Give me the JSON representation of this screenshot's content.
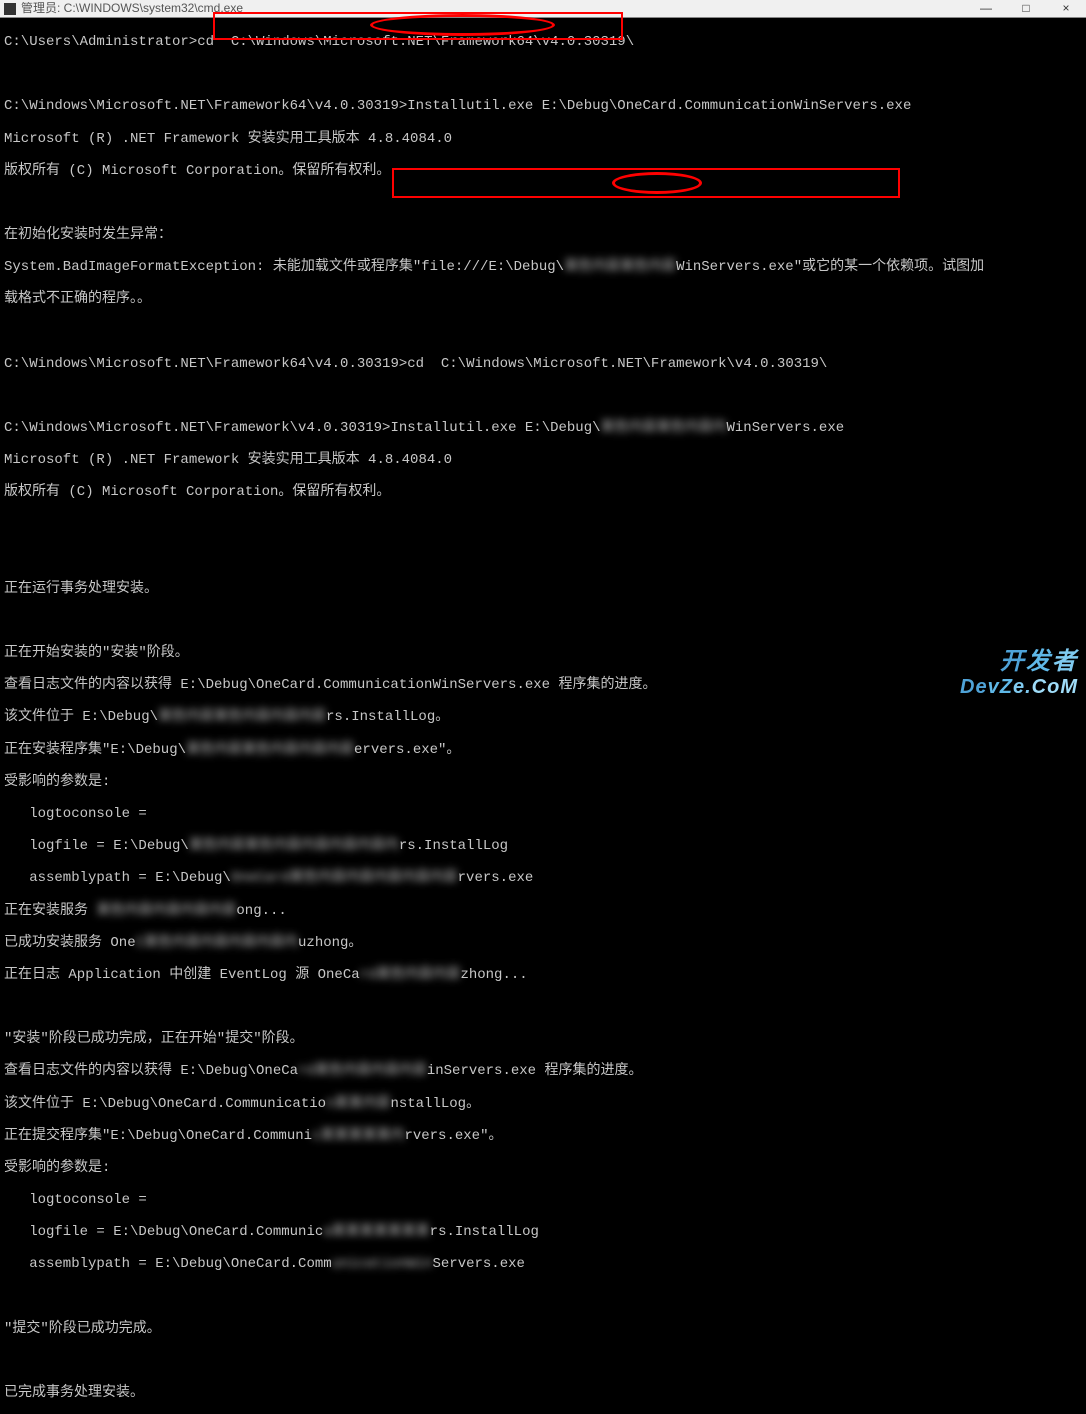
{
  "titlebar": {
    "text": "管理员: C:\\WINDOWS\\system32\\cmd.exe",
    "min": "—",
    "max": "□",
    "close": "×"
  },
  "lines": {
    "l1_prompt": "C:\\Users\\Administrator>",
    "l1_cmd": "cd  C:\\Windows\\Microsoft.NET\\Framework64\\v4.0.30319\\",
    "l2": "",
    "l3": "C:\\Windows\\Microsoft.NET\\Framework64\\v4.0.30319>Installutil.exe E:\\Debug\\OneCard.CommunicationWinServers.exe",
    "l4": "Microsoft (R) .NET Framework 安装实用工具版本 4.8.4084.0",
    "l5": "版权所有 (C) Microsoft Corporation。保留所有权利。",
    "l6": "",
    "l7": "在初始化安装时发生异常：",
    "l8a": "System.BadImageFormatException: 未能加载文件或程序集\"file:///E:\\Debug\\",
    "l8b_blur": "某些内容某些内容",
    "l8c": "WinServers.exe\"或它的某一个依赖项。试图加",
    "l9": "载格式不正确的程序。。",
    "l10": "",
    "l11_prompt": "C:\\Windows\\Microsoft.NET\\Framework64\\v4.0.30319>",
    "l11_cmd": "cd  C:\\Windows\\Microsoft.NET\\Framework\\v4.0.30319\\",
    "l12": "",
    "l13a": "C:\\Windows\\Microsoft.NET\\Framework\\v4.0.30319>Installutil.exe E:\\Debug\\",
    "l13b_blur": "某些内容某些内容内",
    "l13c": "WinServers.exe",
    "l14": "Microsoft (R) .NET Framework 安装实用工具版本 4.8.4084.0",
    "l15": "版权所有 (C) Microsoft Corporation。保留所有权利。",
    "l16": "",
    "l17": "",
    "l18": "正在运行事务处理安装。",
    "l19": "",
    "l20": "正在开始安装的\"安装\"阶段。",
    "l21": "查看日志文件的内容以获得 E:\\Debug\\OneCard.CommunicationWinServers.exe 程序集的进度。",
    "l22a": "该文件位于 E:\\Debug\\",
    "l22b_blur": "某些内容某些内容内容内容",
    "l22c": "rs.InstallLog。",
    "l23a": "正在安装程序集\"E:\\Debug\\",
    "l23b_blur": "某些内容某些内容内容内容",
    "l23c": "ervers.exe\"。",
    "l24": "受影响的参数是:",
    "l25": "   logtoconsole = ",
    "l26a": "   logfile = E:\\Debug\\",
    "l26b_blur": "某些内容某些内容内容内容内容内",
    "l26c": "rs.InstallLog",
    "l27a": "   assemblypath = E:\\Debug\\",
    "l27b_blur": "OneCard某些内容内容内容内容内容",
    "l27c": "rvers.exe",
    "l28a": "正在安装服务 ",
    "l28b_blur": "某些内容内容内容内容",
    "l28c": "ong...",
    "l29a": "已成功安装服务 One",
    "l29b_blur": "C某些内容内容内容内容内",
    "l29c": "uzhong。",
    "l30a": "正在日志 Application 中创建 EventLog 源 OneCa",
    "l30b_blur": "rd某些内容内容",
    "l30c": "zhong...",
    "l31": "",
    "l32": "\"安装\"阶段已成功完成，正在开始\"提交\"阶段。",
    "l33a": "查看日志文件的内容以获得 E:\\Debug\\OneCa",
    "l33b_blur": "rd某些内容内容内容",
    "l33c": "inServers.exe 程序集的进度。",
    "l34a": "该文件位于 E:\\Debug\\OneCard.Communicatio",
    "l34b_blur": "n某某内容",
    "l34c": "nstallLog。",
    "l35a": "正在提交程序集\"E:\\Debug\\OneCard.Communi",
    "l35b_blur": "c某某某某某内",
    "l35c": "rvers.exe\"。",
    "l36": "受影响的参数是:",
    "l37": "   logtoconsole = ",
    "l38a": "   logfile = E:\\Debug\\OneCard.Communic",
    "l38b_blur": "a某某某某某某某",
    "l38c": "rs.InstallLog",
    "l39a": "   assemblypath = E:\\Debug\\OneCard.Comm",
    "l39b_blur": "unicationWin",
    "l39c": "Servers.exe",
    "l40": "",
    "l41": "\"提交\"阶段已成功完成。",
    "l42": "",
    "l43": "已完成事务处理安装。"
  },
  "watermark": {
    "cn": "开发者",
    "en": "DevZe.CoM"
  }
}
